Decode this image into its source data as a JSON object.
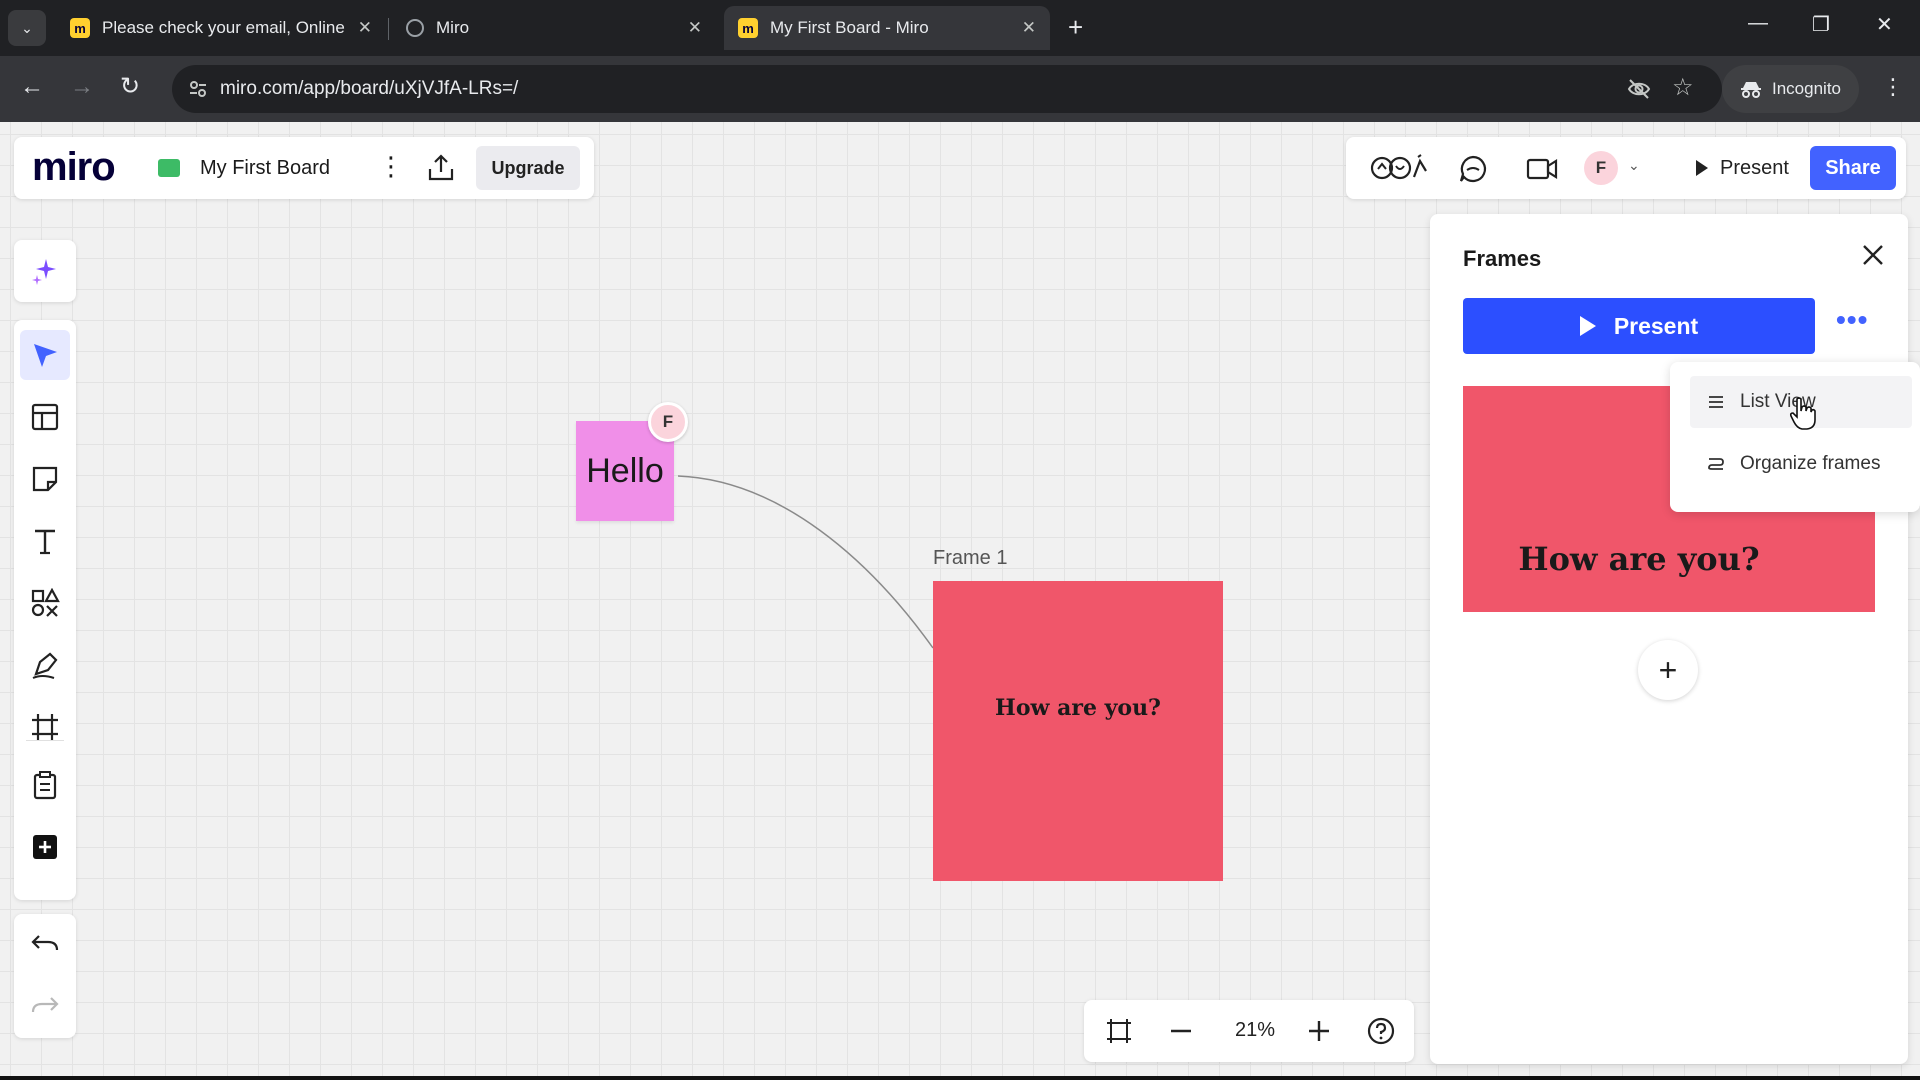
{
  "browser": {
    "tabs": [
      {
        "title": "Please check your email, Online",
        "close": "✕"
      },
      {
        "title": "Miro",
        "close": "✕"
      },
      {
        "title": "My First Board - Miro",
        "close": "✕"
      }
    ],
    "new_tab": "+",
    "window_controls": {
      "minimize": "—",
      "restore": "❐",
      "close": "✕"
    },
    "url": "miro.com/app/board/uXjVJfA-LRs=/",
    "incognito_label": "Incognito"
  },
  "board_header": {
    "logo": "miro",
    "board_name": "My First Board",
    "upgrade_label": "Upgrade"
  },
  "top_right": {
    "avatar_initial": "F",
    "present_label": "Present",
    "share_label": "Share"
  },
  "canvas": {
    "sticky_note_text": "Hello",
    "cursor_initial": "F",
    "frame_label": "Frame 1",
    "frame_text": "How are you?",
    "frame_color": "#f0566a",
    "sticky_color": "#f08fe8"
  },
  "zoom": {
    "level": "21%"
  },
  "frames_panel": {
    "title": "Frames",
    "present_label": "Present",
    "more": "•••",
    "thumb_text": "How are you?",
    "add": "+",
    "menu": [
      {
        "label": "List View",
        "icon": "list-icon"
      },
      {
        "label": "Organize frames",
        "icon": "organize-icon"
      }
    ]
  },
  "colors": {
    "accent": "#4262ff",
    "present_button": "#2c4fff"
  }
}
